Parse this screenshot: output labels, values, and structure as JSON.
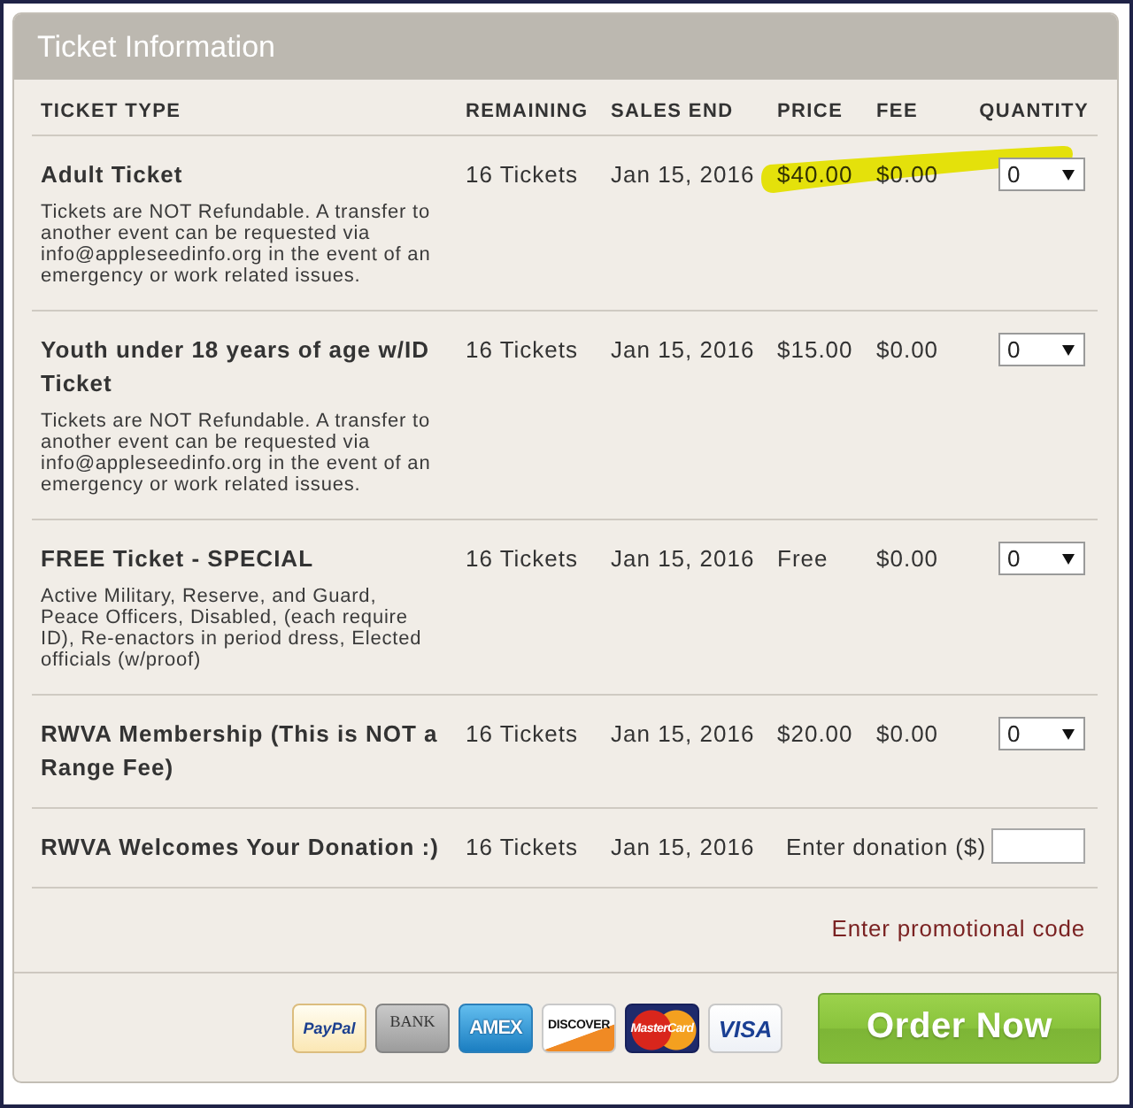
{
  "panel": {
    "title": "Ticket Information"
  },
  "table": {
    "columns": [
      "TICKET TYPE",
      "REMAINING",
      "SALES END",
      "PRICE",
      "FEE",
      "QUANTITY"
    ],
    "rows": [
      {
        "kind": "select",
        "name": "Adult Ticket",
        "description": "Tickets are NOT Refundable. A transfer to another event can be requested via info@appleseedinfo.org in the event of an emergency or work related issues.",
        "remaining": "16 Tickets",
        "sales_end": "Jan 15, 2016",
        "price": "$40.00",
        "fee": "$0.00",
        "quantity": "0",
        "highlighted": true
      },
      {
        "kind": "select",
        "name": "Youth under 18 years of age w/ID Ticket",
        "description": "Tickets are NOT Refundable. A transfer to another event can be requested via info@appleseedinfo.org in the event of an emergency or work related issues.",
        "remaining": "16 Tickets",
        "sales_end": "Jan 15, 2016",
        "price": "$15.00",
        "fee": "$0.00",
        "quantity": "0",
        "highlighted": false
      },
      {
        "kind": "select",
        "name": "FREE Ticket - SPECIAL",
        "description": "Active Military, Reserve, and Guard, Peace Officers, Disabled, (each require ID), Re-enactors in period dress, Elected officials (w/proof)",
        "remaining": "16 Tickets",
        "sales_end": "Jan 15, 2016",
        "price": "Free",
        "fee": "$0.00",
        "quantity": "0",
        "highlighted": false
      },
      {
        "kind": "select",
        "name": "RWVA Membership (This is NOT a Range Fee)",
        "remaining": "16 Tickets",
        "sales_end": "Jan 15, 2016",
        "price": "$20.00",
        "fee": "$0.00",
        "quantity": "0",
        "highlighted": false
      },
      {
        "kind": "donation",
        "name": "RWVA Welcomes Your Donation :)",
        "remaining": "16 Tickets",
        "sales_end": "Jan 15, 2016",
        "donation_label": "Enter donation ($)",
        "highlighted": false
      }
    ]
  },
  "promo_link": "Enter promotional code",
  "payment_methods": [
    {
      "kind": "paypal",
      "label": "PayPal"
    },
    {
      "kind": "bank",
      "label": "BANK"
    },
    {
      "kind": "amex",
      "label": "AMEX"
    },
    {
      "kind": "discover",
      "label": "DISCOVER"
    },
    {
      "kind": "mastercard",
      "label": "MasterCard"
    },
    {
      "kind": "visa",
      "label": "VISA"
    }
  ],
  "order_button": "Order Now"
}
